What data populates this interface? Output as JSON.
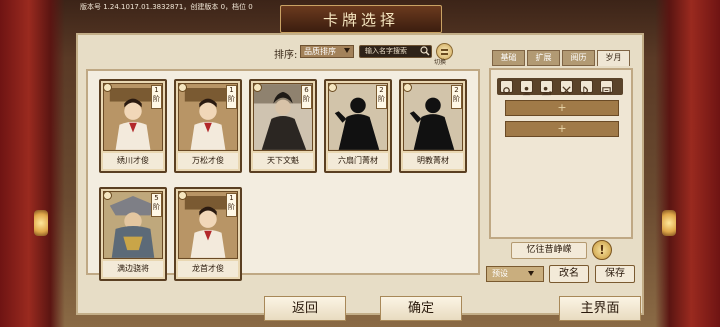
{
  "version_text": "版本号 1.24.1017.01.3832871，创建版本 0，档位 0",
  "title": "卡牌选择",
  "sort": {
    "label": "排序:",
    "selected": "品质排序",
    "search_placeholder": "输入名字搜索",
    "toggle_label": "切换"
  },
  "tabs": [
    {
      "label": "基础"
    },
    {
      "label": "扩展"
    },
    {
      "label": "阅历"
    },
    {
      "label": "岁月"
    }
  ],
  "active_tab": "岁月",
  "cards": [
    {
      "name": "绣川才俊",
      "level": "1",
      "unit": "阶",
      "style": "scholar"
    },
    {
      "name": "万松才俊",
      "level": "1",
      "unit": "阶",
      "style": "scholar"
    },
    {
      "name": "天下文魁",
      "level": "6",
      "unit": "阶",
      "style": "dark"
    },
    {
      "name": "六扇门菁材",
      "level": "2",
      "unit": "阶",
      "style": "silhouette"
    },
    {
      "name": "明教菁材",
      "level": "2",
      "unit": "阶",
      "style": "silhouette"
    },
    {
      "name": "满边骁将",
      "level": "5",
      "unit": "阶",
      "style": "warrior"
    },
    {
      "name": "龙首才俊",
      "level": "1",
      "unit": "阶",
      "style": "scholar"
    }
  ],
  "filter_icons": [
    "gear-icon",
    "person-icon",
    "person-alt-icon",
    "swords-icon",
    "bow-icon",
    "scroll-icon"
  ],
  "slots": [
    {
      "symbol": "+"
    },
    {
      "symbol": "+"
    }
  ],
  "memory_button": "忆往昔峥嵘",
  "warning_symbol": "!",
  "preset": {
    "selected": "预设"
  },
  "rename_button": "改名",
  "save_button": "保存",
  "bottom": {
    "back": "返回",
    "confirm": "确定",
    "main_menu": "主界面"
  },
  "colors": {
    "panel": "#e7ddc6",
    "accent": "#c9a264",
    "dark_wood": "#5a3f22"
  }
}
